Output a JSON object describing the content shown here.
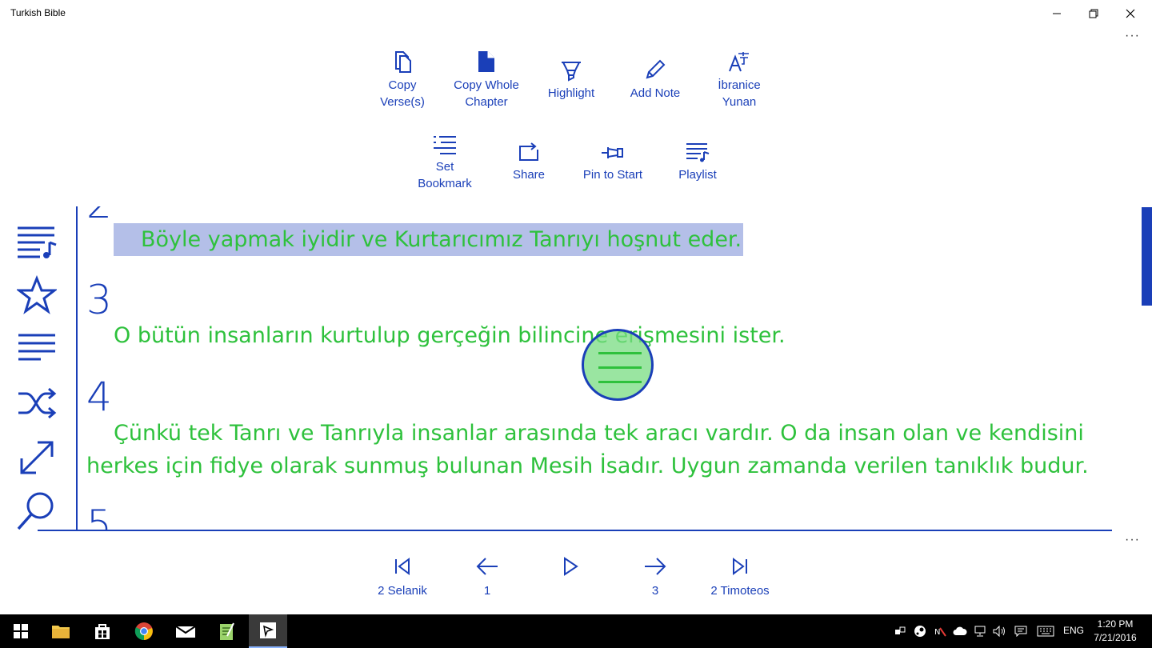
{
  "window": {
    "title": "Turkish Bible"
  },
  "toolbar_top": [
    {
      "label": "Copy\nVerse(s)",
      "icon": "copy-icon"
    },
    {
      "label": "Copy Whole\nChapter",
      "icon": "document-icon"
    },
    {
      "label": "Highlight",
      "icon": "highlighter-icon"
    },
    {
      "label": "Add Note",
      "icon": "pencil-icon"
    },
    {
      "label": "İbranice\nYunan",
      "icon": "language-icon"
    }
  ],
  "toolbar_bottom": [
    {
      "label": "Set\nBookmark",
      "icon": "bookmark-list-icon"
    },
    {
      "label": "Share",
      "icon": "share-icon"
    },
    {
      "label": "Pin to Start",
      "icon": "pin-icon"
    },
    {
      "label": "Playlist",
      "icon": "playlist-icon"
    }
  ],
  "sidebar": [
    "playlist-icon",
    "star-icon",
    "list-icon",
    "shuffle-icon",
    "fullscreen-icon",
    "search-icon"
  ],
  "verses": [
    {
      "num": "2",
      "text": "Böyle yapmak iyidir ve Kurtarıcımız Tanrıyı hoşnut eder.",
      "highlighted": true
    },
    {
      "num": "3",
      "text": "O bütün insanların kurtulup gerçeğin bilincine erişmesini ister.",
      "highlighted": false
    },
    {
      "num": "4",
      "text": "Çünkü tek Tanrı ve Tanrıyla insanlar arasında tek aracı vardır. O da insan olan ve kendisini herkes için fidye olarak sunmuş bulunan Mesih İsadır. Uygun zamanda verilen tanıklık budur.",
      "highlighted": false
    },
    {
      "num": "5",
      "text": "",
      "highlighted": false
    }
  ],
  "nav": {
    "first": "2 Selanik",
    "prev": "1",
    "play": "",
    "next": "3",
    "last": "2 Timoteos"
  },
  "taskbar": {
    "lang": "ENG",
    "time": "1:20 PM",
    "date": "7/21/2016"
  },
  "colors": {
    "accent": "#1a3fb8",
    "verse_text": "#2ec13c",
    "highlight": "#b4bfe8"
  }
}
